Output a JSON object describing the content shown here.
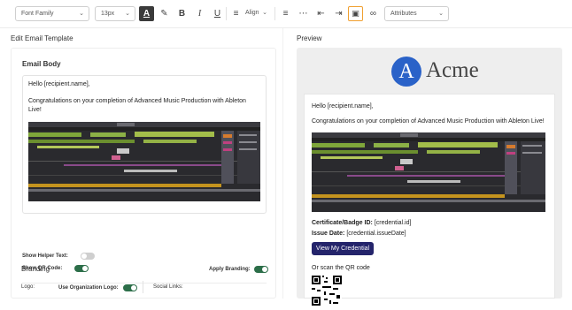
{
  "toolbar": {
    "font_family": "Font Family",
    "font_size": "13px",
    "align": "Align",
    "attributes": "Attributes"
  },
  "left": {
    "title": "Edit Email Template",
    "email_body_label": "Email Body",
    "editor": {
      "greeting": "Hello [recipient.name],",
      "message": "Congratulations on your completion of Advanced Music Production with Ableton Live!"
    },
    "show_helper_text": {
      "label": "Show Helper Text:",
      "on": false
    },
    "show_qr_code": {
      "label": "Show QR Code:",
      "on": true
    },
    "branding": {
      "title": "Branding",
      "apply_label": "Apply Branding:",
      "apply_on": true,
      "logo_label": "Logo:",
      "use_org_logo_label": "Use Organization Logo:",
      "use_org_logo_on": true,
      "social_links_label": "Social Links:"
    }
  },
  "right": {
    "title": "Preview",
    "brand_letter": "A",
    "brand_name": "Acme",
    "greeting": "Hello [recipient.name],",
    "message": "Congratulations on your completion of Advanced Music Production with Ableton Live!",
    "cert_label": "Certificate/Badge ID:",
    "cert_value": "[credential.id]",
    "issue_label": "Issue Date:",
    "issue_value": "[credential.issueDate]",
    "button": "View My Credential",
    "qr_label": "Or scan the QR code"
  },
  "colors": {
    "accent": "#2c6e49",
    "brand": "#2a62c8",
    "button": "#24246b",
    "active_outline": "#f0a030"
  }
}
